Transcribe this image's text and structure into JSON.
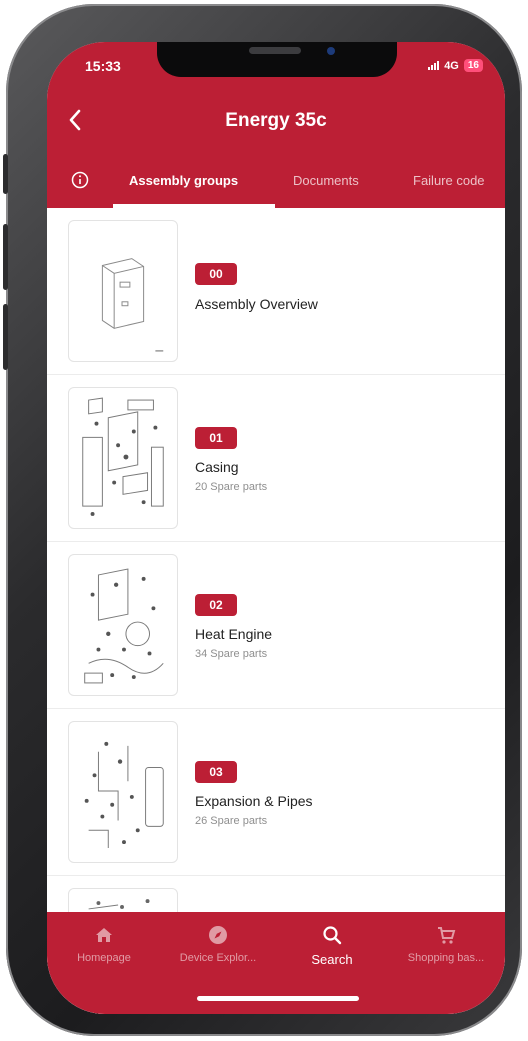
{
  "status_bar": {
    "time": "15:33",
    "network": "4G",
    "battery": "16"
  },
  "header": {
    "title": "Energy 35c",
    "back_icon": "chevron-left-icon"
  },
  "tabs": [
    {
      "label": "Assembly groups",
      "active": true
    },
    {
      "label": "Documents",
      "active": false
    },
    {
      "label": "Failure code",
      "active": false
    }
  ],
  "info_icon": "info-circle-icon",
  "assembly_groups": [
    {
      "number": "00",
      "name": "Assembly Overview",
      "parts": ""
    },
    {
      "number": "01",
      "name": "Casing",
      "parts": "20 Spare parts"
    },
    {
      "number": "02",
      "name": "Heat Engine",
      "parts": "34 Spare parts"
    },
    {
      "number": "03",
      "name": "Expansion & Pipes",
      "parts": "26 Spare parts"
    }
  ],
  "bottom_nav": [
    {
      "label": "Homepage",
      "icon": "home-icon",
      "active": false
    },
    {
      "label": "Device Explor...",
      "icon": "compass-icon",
      "active": false
    },
    {
      "label": "Search",
      "icon": "search-icon",
      "active": true
    },
    {
      "label": "Shopping bas...",
      "icon": "cart-icon",
      "active": false
    }
  ],
  "colors": {
    "brand_red": "#bc1f35",
    "white": "#ffffff",
    "battery": "#ff4f7a"
  }
}
